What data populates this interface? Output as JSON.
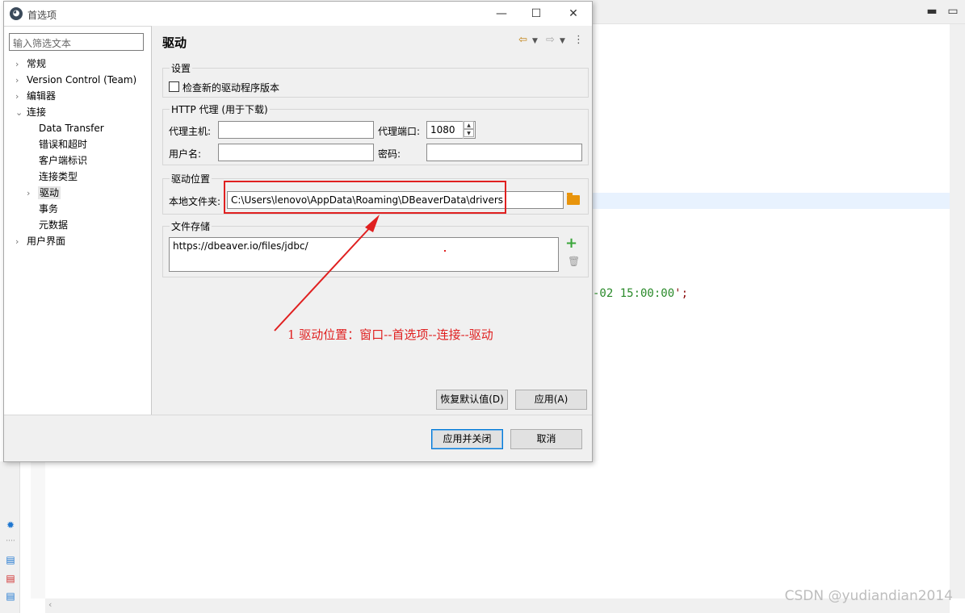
{
  "dialog": {
    "title": "首选项",
    "filter_placeholder": "输入筛选文本",
    "page_title": "驱动",
    "colors": {
      "accent": "#0078d7",
      "annotation": "#e02020",
      "folder": "#e8940c",
      "add": "#3aa63a"
    }
  },
  "tree": [
    {
      "label": "常规",
      "expander": "›"
    },
    {
      "label": "Version Control (Team)",
      "expander": "›"
    },
    {
      "label": "编辑器",
      "expander": "›"
    },
    {
      "label": "连接",
      "expander": "⌄"
    },
    {
      "label": "Data Transfer",
      "expander": ""
    },
    {
      "label": "错误和超时",
      "expander": ""
    },
    {
      "label": "客户端标识",
      "expander": ""
    },
    {
      "label": "连接类型",
      "expander": ""
    },
    {
      "label": "驱动",
      "expander": "›",
      "selected": true
    },
    {
      "label": "事务",
      "expander": ""
    },
    {
      "label": "元数据",
      "expander": ""
    },
    {
      "label": "用户界面",
      "expander": "›"
    }
  ],
  "settings": {
    "group_label": "设置",
    "check_new_version_label": "检查新的驱动程序版本",
    "check_new_version_checked": false
  },
  "proxy": {
    "group_label": "HTTP 代理 (用于下载)",
    "host_label": "代理主机:",
    "host_value": "",
    "port_label": "代理端口:",
    "port_value": "1080",
    "user_label": "用户名:",
    "user_value": "",
    "password_label": "密码:",
    "password_value": ""
  },
  "driver_location": {
    "group_label": "驱动位置",
    "local_folder_label": "本地文件夹:",
    "local_folder_value": "C:\\Users\\lenovo\\AppData\\Roaming\\DBeaverData\\drivers"
  },
  "file_storage": {
    "group_label": "文件存储",
    "items": [
      "https://dbeaver.io/files/jdbc/"
    ]
  },
  "buttons": {
    "restore_defaults": "恢复默认值(D)",
    "apply": "应用(A)",
    "apply_and_close": "应用并关闭",
    "cancel": "取消"
  },
  "annotation": {
    "text": "1 驱动位置：窗口--首选项--连接--驱动"
  },
  "background": {
    "code_fragment_value": "-02 15:00:00",
    "code_fragment_punct": "';"
  },
  "watermark": "CSDN @yudiandian2014"
}
